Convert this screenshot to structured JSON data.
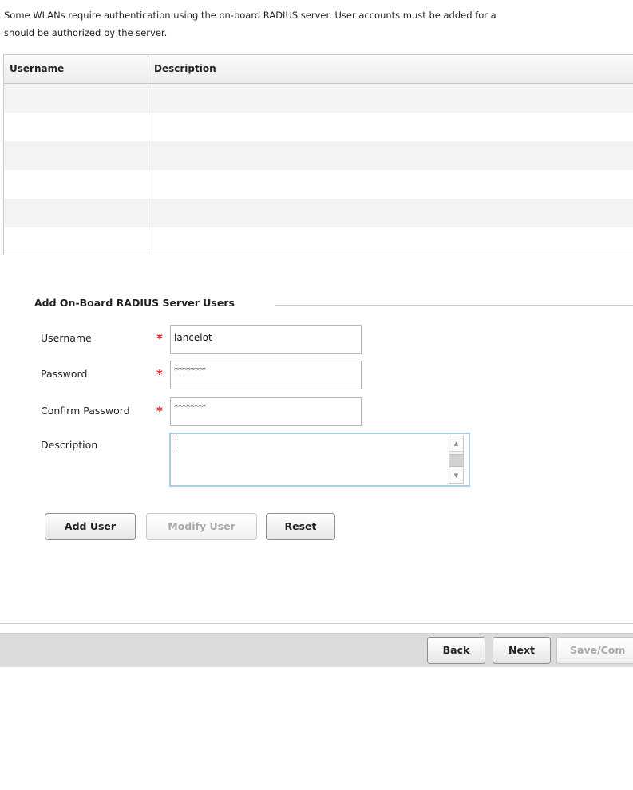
{
  "intro": {
    "line1": "Some WLANs require authentication using the on-board RADIUS server.  User accounts must be added for a",
    "line2": "should be authorized by the server."
  },
  "users_table": {
    "columns": [
      "Username",
      "Description"
    ],
    "rows": []
  },
  "add_users": {
    "legend": "Add On-Board RADIUS Server Users",
    "username_label": "Username",
    "username_value": "lancelot",
    "password_label": "Password",
    "password_value": "********",
    "confirm_label": "Confirm Password",
    "confirm_value": "********",
    "description_label": "Description",
    "description_value": "",
    "required_mark": "*"
  },
  "buttons": {
    "add_user": "Add User",
    "modify_user": "Modify User",
    "reset": "Reset"
  },
  "footer": {
    "back": "Back",
    "next": "Next",
    "save": "Save/Com"
  },
  "colors": {
    "required": "#e02020",
    "focus_border": "#a9cfe3",
    "footer_bg": "#dcdcdc"
  }
}
